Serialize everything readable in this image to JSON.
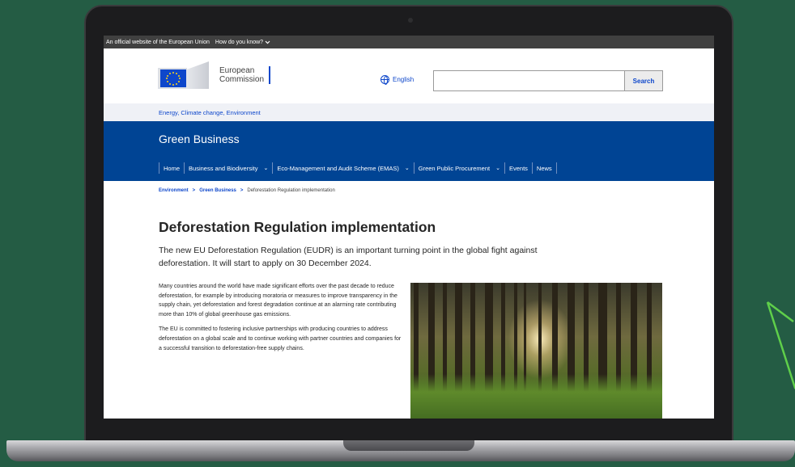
{
  "eu_banner": {
    "official_text": "An official website of the European Union",
    "how_text": "How do you know?"
  },
  "header": {
    "logo_line1": "European",
    "logo_line2": "Commission",
    "language": "English",
    "search_placeholder": "",
    "search_button": "Search"
  },
  "tagline": "Energy, Climate change, Environment",
  "site_name": "Green Business",
  "nav": [
    {
      "label": "Home"
    },
    {
      "label": "Business and Biodiversity"
    },
    {
      "label": "Eco-Management and Audit Scheme (EMAS)"
    },
    {
      "label": "Green Public Procurement"
    },
    {
      "label": "Events"
    },
    {
      "label": "News"
    }
  ],
  "breadcrumb": {
    "item1": "Environment",
    "item2": "Green Business",
    "current": "Deforestation Regulation implementation",
    "separator": ">"
  },
  "page": {
    "title": "Deforestation Regulation implementation",
    "intro": "The new EU Deforestation Regulation (EUDR) is an important turning point in the global fight against deforestation. It will start to apply on 30 December 2024.",
    "paragraph1": "Many countries around the world have made significant efforts over the past decade to reduce deforestation, for example by introducing moratoria or measures to improve transparency in the supply chain, yet deforestation and forest degradation continue at an alarming rate contributing more than 10% of global greenhouse gas emissions.",
    "paragraph2": "The EU is committed to fostering inclusive partnerships with producing countries to address deforestation on a global scale and to continue working with partner countries and companies for a successful transition to deforestation-free supply chains."
  },
  "colors": {
    "background": "#245c44",
    "eu_blue": "#004494",
    "link_blue": "#0e47cb"
  },
  "icons": {
    "language": "globe-icon",
    "dropdown": "chevron-down-icon"
  }
}
